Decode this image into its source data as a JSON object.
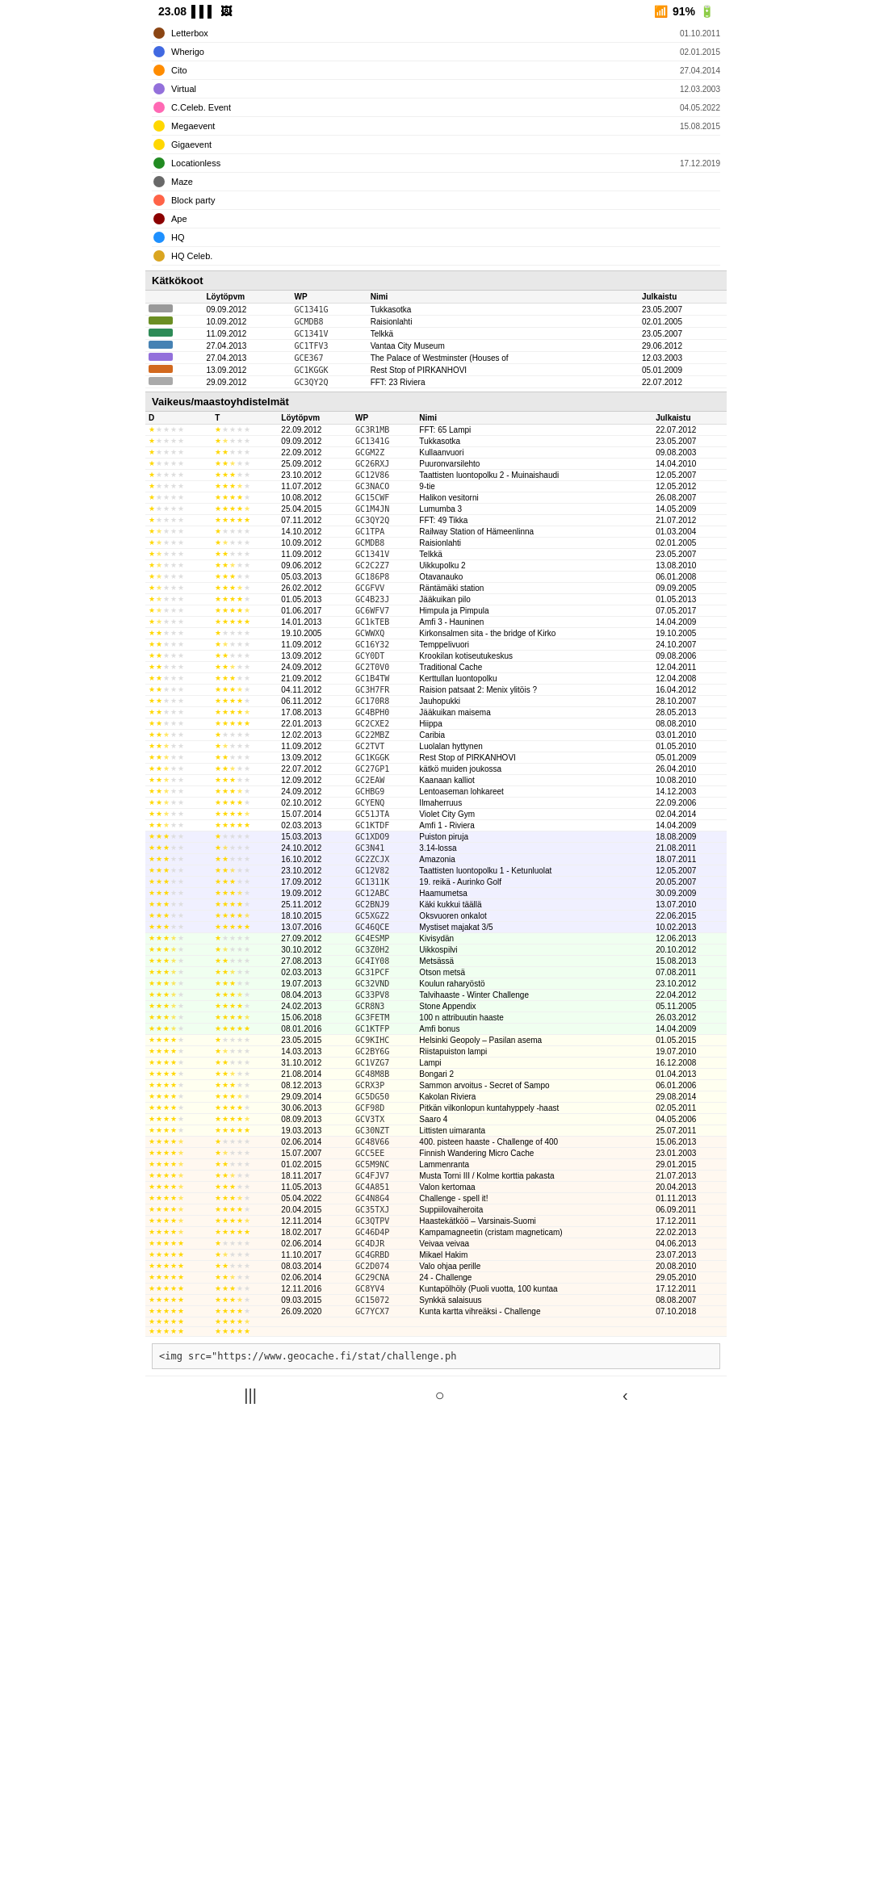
{
  "statusBar": {
    "time": "23.08",
    "battery": "91%",
    "signal": "WiFi+4G"
  },
  "cacheTypes": [
    {
      "icon": "📦",
      "name": "Letterbox",
      "date": "01.10.2011"
    },
    {
      "icon": "🌍",
      "name": "Wherigo",
      "date": "02.01.2015"
    },
    {
      "icon": "🟠",
      "name": "Cito",
      "date": "27.04.2014"
    },
    {
      "icon": "💻",
      "name": "Virtual",
      "date": "12.03.2003"
    },
    {
      "icon": "🎉",
      "name": "C.Celeb. Event",
      "date": "04.05.2022"
    },
    {
      "icon": "⭐",
      "name": "Megaevent",
      "date": "15.08.2015"
    },
    {
      "icon": "⭐",
      "name": "Gigaevent",
      "date": ""
    },
    {
      "icon": "🦶",
      "name": "Locationless",
      "date": "17.12.2019"
    },
    {
      "icon": "🌀",
      "name": "Maze",
      "date": ""
    },
    {
      "icon": "🎊",
      "name": "Block party",
      "date": ""
    },
    {
      "icon": "🐒",
      "name": "Ape",
      "date": ""
    },
    {
      "icon": "🏠",
      "name": "HQ",
      "date": ""
    },
    {
      "icon": "👑",
      "name": "HQ Celeb.",
      "date": ""
    }
  ],
  "sections": {
    "katkokoot": {
      "title": "Kätkökoot",
      "columns": [
        "",
        "Löytöpvm",
        "WP",
        "Nimi",
        "Julkaistu"
      ],
      "rows": [
        {
          "size": "Nano",
          "found": "09.09.2012",
          "wp": "GC1341G",
          "name": "Tukkasotka",
          "published": "23.05.2007"
        },
        {
          "size": "Small",
          "found": "10.09.2012",
          "wp": "GCMDB8",
          "name": "Raisionlahti",
          "published": "02.01.2005"
        },
        {
          "size": "Regular",
          "found": "11.09.2012",
          "wp": "GC1341V",
          "name": "Telkkä",
          "published": "23.05.2007"
        },
        {
          "size": "Large",
          "found": "27.04.2013",
          "wp": "GC1TFV3",
          "name": "Vantaa City Museum",
          "published": "29.06.2012"
        },
        {
          "size": "Virtual",
          "found": "27.04.2013",
          "wp": "GCE367",
          "name": "The Palace of Westminster (Houses of",
          "published": "12.03.2003"
        },
        {
          "size": "Other",
          "found": "13.09.2012",
          "wp": "GC1KGGK",
          "name": "Rest Stop of PIRKANHOVI",
          "published": "05.01.2009"
        },
        {
          "size": "Not chosen",
          "found": "29.09.2012",
          "wp": "GC3QY2Q",
          "name": "FFT: 23 Riviera",
          "published": "22.07.2012"
        }
      ]
    },
    "vaikeus": {
      "title": "Vaikeus/maastoyhdistelmät",
      "columns": [
        "D",
        "T",
        "Löytöpvm",
        "WP",
        "Nimi",
        "Julkaistu"
      ],
      "rows": [
        {
          "d": "1",
          "t": "1",
          "found": "22.09.2012",
          "wp": "GC3R1MB",
          "name": "FFT: 65 Lampi",
          "published": "22.07.2012"
        },
        {
          "d": "1",
          "t": "1.5",
          "found": "09.09.2012",
          "wp": "GC1341G",
          "name": "Tukkasotka",
          "published": "23.05.2007"
        },
        {
          "d": "1",
          "t": "2",
          "found": "22.09.2012",
          "wp": "GCGM2Z",
          "name": "Kullaanvuori",
          "published": "09.08.2003"
        },
        {
          "d": "1",
          "t": "2.5",
          "found": "25.09.2012",
          "wp": "GC26RXJ",
          "name": "Puuronvarsilehto",
          "published": "14.04.2010"
        },
        {
          "d": "1",
          "t": "3",
          "found": "23.10.2012",
          "wp": "GC12V86",
          "name": "Taattisten luontopolku 2 - Muinaishaudi",
          "published": "12.05.2007"
        },
        {
          "d": "1",
          "t": "3.5",
          "found": "11.07.2012",
          "wp": "GC3NACO",
          "name": "9-tie",
          "published": "12.05.2012"
        },
        {
          "d": "1",
          "t": "4",
          "found": "10.08.2012",
          "wp": "GC15CWF",
          "name": "Halikon vesitorni",
          "published": "26.08.2007"
        },
        {
          "d": "1",
          "t": "4.5",
          "found": "25.04.2015",
          "wp": "GC1M4JN",
          "name": "Lumumba 3",
          "published": "14.05.2009"
        },
        {
          "d": "1",
          "t": "5",
          "found": "07.11.2012",
          "wp": "GC3QY2Q",
          "name": "FFT: 49 Tikka",
          "published": "21.07.2012"
        },
        {
          "d": "1.5",
          "t": "1",
          "found": "14.10.2012",
          "wp": "GC1TPA",
          "name": "Railway Station of Hämeenlinna",
          "published": "01.03.2004"
        },
        {
          "d": "1.5",
          "t": "1.5",
          "found": "10.09.2012",
          "wp": "GCMDB8",
          "name": "Raisionlahti",
          "published": "02.01.2005"
        },
        {
          "d": "1.5",
          "t": "2",
          "found": "11.09.2012",
          "wp": "GC1341V",
          "name": "Telkkä",
          "published": "23.05.2007"
        },
        {
          "d": "1.5",
          "t": "2.5",
          "found": "09.06.2012",
          "wp": "GC2C2Z7",
          "name": "Uikkupolku 2",
          "published": "13.08.2010"
        },
        {
          "d": "1.5",
          "t": "3",
          "found": "05.03.2013",
          "wp": "GC186P8",
          "name": "Otavanauko",
          "published": "06.01.2008"
        },
        {
          "d": "1.5",
          "t": "3.5",
          "found": "26.02.2012",
          "wp": "GCGFVV",
          "name": "Räntämäki station",
          "published": "09.09.2005"
        },
        {
          "d": "1.5",
          "t": "4",
          "found": "01.05.2013",
          "wp": "GC4B23J",
          "name": "Jääkuikan pilo",
          "published": "01.05.2013"
        },
        {
          "d": "1.5",
          "t": "4.5",
          "found": "01.06.2017",
          "wp": "GC6WFV7",
          "name": "Himpula ja Pimpula",
          "published": "07.05.2017"
        },
        {
          "d": "1.5",
          "t": "5",
          "found": "14.01.2013",
          "wp": "GC1kTEB",
          "name": "Amfi 3 - Hauninen",
          "published": "14.04.2009"
        },
        {
          "d": "2",
          "t": "1",
          "found": "19.10.2005",
          "wp": "GCWWXQ",
          "name": "Kirkonsalmen sita - the bridge of Kirko",
          "published": "19.10.2005"
        },
        {
          "d": "2",
          "t": "1.5",
          "found": "11.09.2012",
          "wp": "GC16Y32",
          "name": "Temppelivuori",
          "published": "24.10.2007"
        },
        {
          "d": "2",
          "t": "2",
          "found": "13.09.2012",
          "wp": "GCY0DT",
          "name": "Krookilan kotiseutukeskus",
          "published": "09.08.2006"
        },
        {
          "d": "2",
          "t": "2.5",
          "found": "24.09.2012",
          "wp": "GC2T0V0",
          "name": "Traditional Cache",
          "published": "12.04.2011"
        },
        {
          "d": "2",
          "t": "3",
          "found": "21.09.2012",
          "wp": "GC1B4TW",
          "name": "Kerttullan luontopolku",
          "published": "12.04.2008"
        },
        {
          "d": "2",
          "t": "3.5",
          "found": "04.11.2012",
          "wp": "GC3H7FR",
          "name": "Raision patsaat 2: Menix ylitöis ?",
          "published": "16.04.2012"
        },
        {
          "d": "2",
          "t": "4",
          "found": "06.11.2012",
          "wp": "GC170R8",
          "name": "Jauhopukki",
          "published": "28.10.2007"
        },
        {
          "d": "2",
          "t": "4.5",
          "found": "17.08.2013",
          "wp": "GC4BPH0",
          "name": "Jääkuikan maisema",
          "published": "28.05.2013"
        },
        {
          "d": "2",
          "t": "5",
          "found": "22.01.2013",
          "wp": "GC2CXE2",
          "name": "Hiippa",
          "published": "08.08.2010"
        },
        {
          "d": "2.5",
          "t": "1",
          "found": "12.02.2013",
          "wp": "GC22MBZ",
          "name": "Caribia",
          "published": "03.01.2010"
        },
        {
          "d": "2.5",
          "t": "1.5",
          "found": "11.09.2012",
          "wp": "GC2TVT",
          "name": "Luolalan hyttynen",
          "published": "01.05.2010"
        },
        {
          "d": "2.5",
          "t": "2",
          "found": "13.09.2012",
          "wp": "GC1KGGK",
          "name": "Rest Stop of PIRKANHOVI",
          "published": "05.01.2009"
        },
        {
          "d": "2.5",
          "t": "2.5",
          "found": "22.07.2012",
          "wp": "GC27GP1",
          "name": "kätkö muiden joukossa",
          "published": "26.04.2010"
        },
        {
          "d": "2.5",
          "t": "3",
          "found": "12.09.2012",
          "wp": "GC2EAW",
          "name": "Kaanaan kalliot",
          "published": "10.08.2010"
        },
        {
          "d": "2.5",
          "t": "3.5",
          "found": "24.09.2012",
          "wp": "GCHBG9",
          "name": "Lentoaseman lohkareet",
          "published": "14.12.2003"
        },
        {
          "d": "2.5",
          "t": "4",
          "found": "02.10.2012",
          "wp": "GCYENQ",
          "name": "Ilmaherruus",
          "published": "22.09.2006"
        },
        {
          "d": "2.5",
          "t": "4.5",
          "found": "15.07.2014",
          "wp": "GC51JTA",
          "name": "Violet City Gym",
          "published": "02.04.2014"
        },
        {
          "d": "2.5",
          "t": "5",
          "found": "02.03.2013",
          "wp": "GC1KTDF",
          "name": "Amfi 1 - Riviera",
          "published": "14.04.2009"
        },
        {
          "d": "3",
          "t": "1",
          "found": "15.03.2013",
          "wp": "GC1XDO9",
          "name": "Puiston piruja",
          "published": "18.08.2009"
        },
        {
          "d": "3",
          "t": "1.5",
          "found": "24.10.2012",
          "wp": "GC3N41",
          "name": "3.14-lossa",
          "published": "21.08.2011"
        },
        {
          "d": "3",
          "t": "2",
          "found": "16.10.2012",
          "wp": "GC2ZCJX",
          "name": "Amazonia",
          "published": "18.07.2011"
        },
        {
          "d": "3",
          "t": "2.5",
          "found": "23.10.2012",
          "wp": "GC12V82",
          "name": "Taattisten luontopolku 1 - Ketunluolat",
          "published": "12.05.2007"
        },
        {
          "d": "3",
          "t": "3",
          "found": "17.09.2012",
          "wp": "GC1311K",
          "name": "19. reikä - Aurinko Golf",
          "published": "20.05.2007"
        },
        {
          "d": "3",
          "t": "3.5",
          "found": "19.09.2012",
          "wp": "GC12ABC",
          "name": "Haamumetsa",
          "published": "30.09.2009"
        },
        {
          "d": "3",
          "t": "4",
          "found": "25.11.2012",
          "wp": "GC2BNJ9",
          "name": "Käki kukkui täällä",
          "published": "13.07.2010"
        },
        {
          "d": "3",
          "t": "4.5",
          "found": "18.10.2015",
          "wp": "GC5XGZ2",
          "name": "Oksvuoren onkalot",
          "published": "22.06.2015"
        },
        {
          "d": "3",
          "t": "5",
          "found": "13.07.2016",
          "wp": "GC46QCE",
          "name": "Mystiset majakat 3/5",
          "published": "10.02.2013"
        },
        {
          "d": "3.5",
          "t": "1",
          "found": "27.09.2012",
          "wp": "GC4ESMP",
          "name": "Kivisydän",
          "published": "12.06.2013"
        },
        {
          "d": "3.5",
          "t": "1.5",
          "found": "30.10.2012",
          "wp": "GC3Z0H2",
          "name": "Uikkospilvi",
          "published": "20.10.2012"
        },
        {
          "d": "3.5",
          "t": "2",
          "found": "27.08.2013",
          "wp": "GC4IY08",
          "name": "Metsässä",
          "published": "15.08.2013"
        },
        {
          "d": "3.5",
          "t": "2.5",
          "found": "02.03.2013",
          "wp": "GC31PCF",
          "name": "Otson metsä",
          "published": "07.08.2011"
        },
        {
          "d": "3.5",
          "t": "3",
          "found": "19.07.2013",
          "wp": "GC32VND",
          "name": "Koulun raharyöstö",
          "published": "23.10.2012"
        },
        {
          "d": "3.5",
          "t": "3.5",
          "found": "08.04.2013",
          "wp": "GC33PV8",
          "name": "Talvihaaste - Winter Challenge",
          "published": "22.04.2012"
        },
        {
          "d": "3.5",
          "t": "4",
          "found": "24.02.2013",
          "wp": "GCR8N3",
          "name": "Stone Appendix",
          "published": "05.11.2005"
        },
        {
          "d": "3.5",
          "t": "4.5",
          "found": "15.06.2018",
          "wp": "GC3FETM",
          "name": "100 n attribuutin haaste",
          "published": "26.03.2012"
        },
        {
          "d": "3.5",
          "t": "5",
          "found": "08.01.2016",
          "wp": "GC1KTFP",
          "name": "Amfi bonus",
          "published": "14.04.2009"
        },
        {
          "d": "4",
          "t": "1",
          "found": "23.05.2015",
          "wp": "GC9KIHC",
          "name": "Helsinki Geopoly – Pasilan asema",
          "published": "01.05.2015"
        },
        {
          "d": "4",
          "t": "1.5",
          "found": "14.03.2013",
          "wp": "GC2BY6G",
          "name": "Riistapuiston lampi",
          "published": "19.07.2010"
        },
        {
          "d": "4",
          "t": "2",
          "found": "31.10.2012",
          "wp": "GC1VZG7",
          "name": "Lampi",
          "published": "16.12.2008"
        },
        {
          "d": "4",
          "t": "2.5",
          "found": "21.08.2014",
          "wp": "GC48M8B",
          "name": "Bongari 2",
          "published": "01.04.2013"
        },
        {
          "d": "4",
          "t": "3",
          "found": "08.12.2013",
          "wp": "GCRX3P",
          "name": "Sammon arvoitus - Secret of Sampo",
          "published": "06.01.2006"
        },
        {
          "d": "4",
          "t": "3.5",
          "found": "29.09.2014",
          "wp": "GC5DG50",
          "name": "Kakolan Riviera",
          "published": "29.08.2014"
        },
        {
          "d": "4",
          "t": "4",
          "found": "30.06.2013",
          "wp": "GCF98D",
          "name": "Pitkän vilkonlopun kuntahyppely -haast",
          "published": "02.05.2011"
        },
        {
          "d": "4",
          "t": "4.5",
          "found": "08.09.2013",
          "wp": "GCV3TX",
          "name": "Saaro 4",
          "published": "04.05.2006"
        },
        {
          "d": "4",
          "t": "5",
          "found": "19.03.2013",
          "wp": "GC30NZT",
          "name": "Littisten uimaranta",
          "published": "25.07.2011"
        },
        {
          "d": "4.5",
          "t": "1",
          "found": "02.06.2014",
          "wp": "GC48V66",
          "name": "400. pisteen haaste - Challenge of 400",
          "published": "15.06.2013"
        },
        {
          "d": "4.5",
          "t": "1.5",
          "found": "15.07.2007",
          "wp": "GCC5EE",
          "name": "Finnish Wandering Micro Cache",
          "published": "23.01.2003"
        },
        {
          "d": "4.5",
          "t": "2",
          "found": "01.02.2015",
          "wp": "GC5M9NC",
          "name": "Lammenranta",
          "published": "29.01.2015"
        },
        {
          "d": "4.5",
          "t": "2.5",
          "found": "18.11.2017",
          "wp": "GC4FJV7",
          "name": "Musta Torni III / Kolme korttia pakasta",
          "published": "21.07.2013"
        },
        {
          "d": "4.5",
          "t": "3",
          "found": "11.05.2013",
          "wp": "GC4A851",
          "name": "Valon kertomaa",
          "published": "20.04.2013"
        },
        {
          "d": "4.5",
          "t": "3.5",
          "found": "05.04.2022",
          "wp": "GC4N8G4",
          "name": "Challenge - spell it!",
          "published": "01.11.2013"
        },
        {
          "d": "4.5",
          "t": "4",
          "found": "20.04.2015",
          "wp": "GC35TXJ",
          "name": "Suppiilovaiheroita",
          "published": "06.09.2011"
        },
        {
          "d": "4.5",
          "t": "4.5",
          "found": "12.11.2014",
          "wp": "GC3QTPV",
          "name": "Haastekätköö – Varsinais-Suomi",
          "published": "17.12.2011"
        },
        {
          "d": "4.5",
          "t": "5",
          "found": "18.02.2017",
          "wp": "GC46D4P",
          "name": "Kampamagneetin (cristam magneticam)",
          "published": "22.02.2013"
        },
        {
          "d": "5",
          "t": "1",
          "found": "02.06.2014",
          "wp": "GC4DJR",
          "name": "Veivaa veivaa",
          "published": "04.06.2013"
        },
        {
          "d": "5",
          "t": "1.5",
          "found": "11.10.2017",
          "wp": "GC4GRBD",
          "name": "Mikael Hakim",
          "published": "23.07.2013"
        },
        {
          "d": "5",
          "t": "2",
          "found": "08.03.2014",
          "wp": "GC2D074",
          "name": "Valo ohjaa perille",
          "published": "20.08.2010"
        },
        {
          "d": "5",
          "t": "2.5",
          "found": "02.06.2014",
          "wp": "GC29CNA",
          "name": "24 - Challenge",
          "published": "29.05.2010"
        },
        {
          "d": "5",
          "t": "3",
          "found": "12.11.2016",
          "wp": "GC8YV4",
          "name": "Kuntapölhöly (Puoli vuotta, 100 kuntaa",
          "published": "17.12.2011"
        },
        {
          "d": "5",
          "t": "3.5",
          "found": "09.03.2015",
          "wp": "GC15072",
          "name": "Synkkä salaisuus",
          "published": "08.08.2007"
        },
        {
          "d": "5",
          "t": "4",
          "found": "26.09.2020",
          "wp": "GC7YCX7",
          "name": "Kunta kartta vihreäksi - Challenge",
          "published": "07.10.2018"
        },
        {
          "d": "5",
          "t": "4.5",
          "found": "",
          "wp": "",
          "name": "",
          "published": ""
        },
        {
          "d": "5",
          "t": "5",
          "found": "",
          "wp": "",
          "name": "",
          "published": ""
        }
      ]
    }
  },
  "bottomText": "<img\nsrc=\"https://www.geocache.fi/stat/challenge.ph",
  "navBar": {
    "back": "‹",
    "home": "○",
    "menu": "|||"
  }
}
